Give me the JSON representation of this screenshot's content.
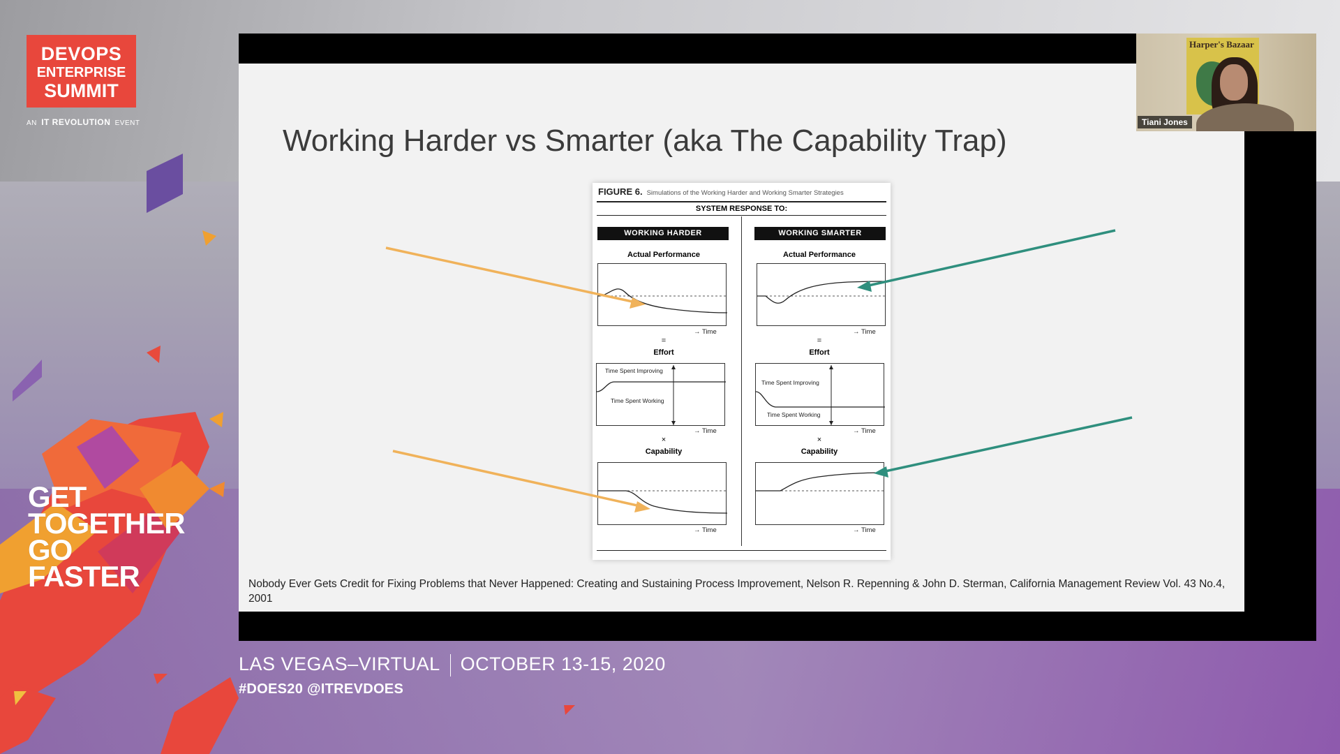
{
  "logo": {
    "line1": "DEVOPS",
    "line2": "ENTERPRISE",
    "line3": "SUMMIT",
    "sub_an": "AN",
    "sub_brand": "IT REVOLUTION",
    "sub_event": "EVENT",
    "color": "#e8473c"
  },
  "tagline": {
    "l1": "GET",
    "l2": "TOGETHER",
    "l3": "GO",
    "l4": "FASTER"
  },
  "slide": {
    "title": "Working Harder vs Smarter (aka The Capability Trap)",
    "figure": {
      "caption_label": "FIGURE 6.",
      "caption_text": "Simulations of the Working Harder and Working Smarter Strategies",
      "system_response": "SYSTEM RESPONSE TO:",
      "left_header": "WORKING HARDER",
      "right_header": "WORKING SMARTER",
      "actual_performance": "Actual Performance",
      "effort": "Effort",
      "capability": "Capability",
      "equals": "=",
      "times": "×",
      "time_label": "→ Time",
      "time_improving": "Time Spent Improving",
      "time_working": "Time Spent Working"
    },
    "citation": "Nobody Ever Gets Credit for Fixing Problems that Never Happened: Creating and Sustaining Process Improvement, Nelson R. Repenning & John D. Sterman, California Management Review Vol. 43 No.4, 2001"
  },
  "arrows": {
    "harder_color": "#f0b25a",
    "smarter_color": "#2f8f7e"
  },
  "webcam": {
    "name": "Tiani Jones",
    "poster_text": "Harper's Bazaar"
  },
  "footer": {
    "location": "LAS VEGAS–VIRTUAL",
    "dates": "OCTOBER 13-15, 2020",
    "hashtags": "#DOES20  @ITREVDOES"
  }
}
